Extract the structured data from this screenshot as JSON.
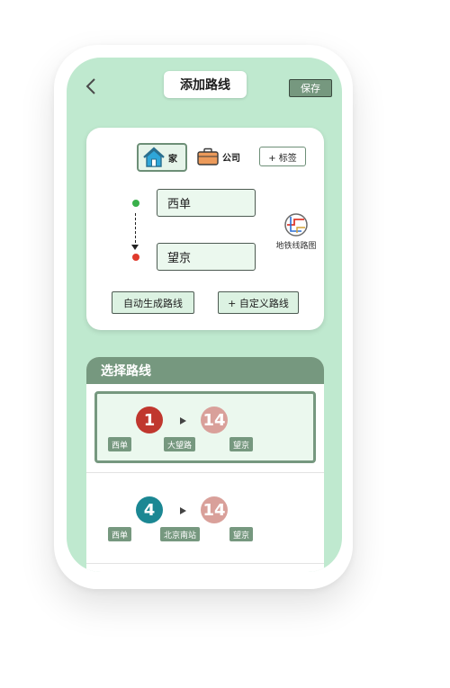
{
  "header": {
    "title": "添加路线",
    "save_label": "保存"
  },
  "tags": {
    "home": "家",
    "company": "公司",
    "add": "+ 标签"
  },
  "route": {
    "from": "西单",
    "to": "望京",
    "metro_map_label": "地铁线路图"
  },
  "actions": {
    "auto": "自动生成路线",
    "custom": "+ 自定义路线"
  },
  "select": {
    "title": "选择路线",
    "options": [
      {
        "lines": [
          {
            "label": "1",
            "color": "#c0372e"
          },
          {
            "label": "14",
            "color": "#d9a09a"
          }
        ],
        "stops": [
          "西单",
          "大望路",
          "望京"
        ]
      },
      {
        "lines": [
          {
            "label": "4",
            "color": "#1b8793"
          },
          {
            "label": "14",
            "color": "#d9a09a"
          }
        ],
        "stops": [
          "西单",
          "北京南站",
          "望京"
        ]
      }
    ]
  },
  "colors": {
    "background": "#bfe9cf",
    "accent": "#76987f"
  }
}
